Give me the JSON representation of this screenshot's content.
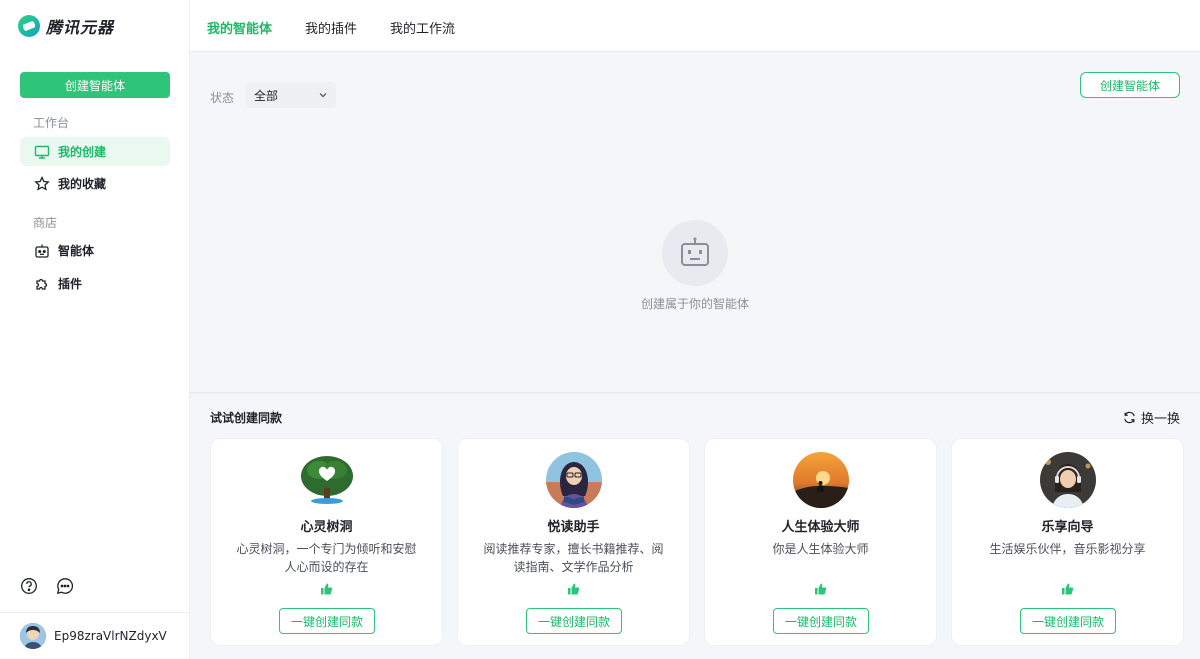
{
  "app": {
    "name": "腾讯元器"
  },
  "sidebar": {
    "create_label": "创建智能体",
    "workspace_label": "工作台",
    "store_label": "商店",
    "items": [
      {
        "label": "我的创建",
        "icon": "monitor-icon",
        "active": true
      },
      {
        "label": "我的收藏",
        "icon": "star-icon",
        "active": false
      },
      {
        "label": "智能体",
        "icon": "robot-icon",
        "active": false
      },
      {
        "label": "插件",
        "icon": "puzzle-icon",
        "active": false
      }
    ],
    "user": {
      "name": "Ep98zraVlrNZdyxV"
    }
  },
  "tabs": [
    {
      "label": "我的智能体",
      "active": true
    },
    {
      "label": "我的插件",
      "active": false
    },
    {
      "label": "我的工作流",
      "active": false
    }
  ],
  "main": {
    "filter_label": "状态",
    "filter_value": "全部",
    "create_label": "创建智能体",
    "empty_text": "创建属于你的智能体"
  },
  "templates": {
    "title": "试试创建同款",
    "refresh_label": "换一换",
    "cards": [
      {
        "title": "心灵树洞",
        "desc": "心灵树洞，一个专门为倾听和安慰人心而设的存在",
        "button": "一键创建同款"
      },
      {
        "title": "悦读助手",
        "desc": "阅读推荐专家，擅长书籍推荐、阅读指南、文学作品分析",
        "button": "一键创建同款"
      },
      {
        "title": "人生体验大师",
        "desc": "你是人生体验大师",
        "button": "一键创建同款"
      },
      {
        "title": "乐享向导",
        "desc": "生活娱乐伙伴，音乐影视分享",
        "button": "一键创建同款"
      }
    ]
  },
  "colors": {
    "accent": "#2ec47a",
    "accent_text": "#1fb869",
    "bg": "#f5f6fa"
  }
}
